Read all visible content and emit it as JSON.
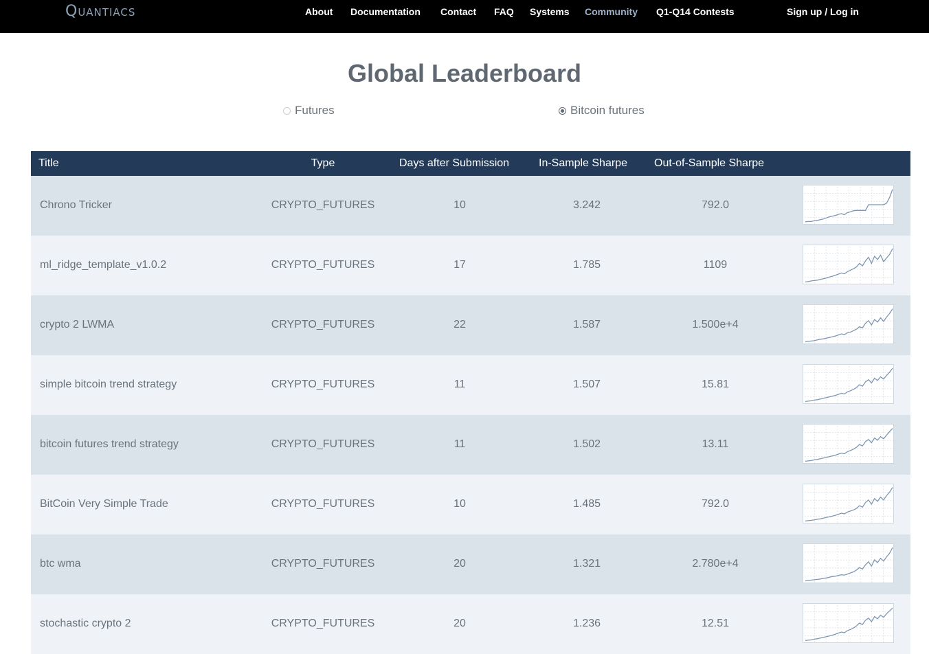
{
  "header": {
    "logo": "Quantiacs",
    "nav": [
      {
        "label": "About"
      },
      {
        "label": "Documentation"
      },
      {
        "label": "Contact"
      },
      {
        "label": "FAQ"
      },
      {
        "label": "Systems"
      },
      {
        "label": "Community"
      },
      {
        "label": "Q1-Q14 Contests"
      }
    ],
    "active_nav": "Community",
    "auth": "Sign up / Log in"
  },
  "page_title": "Global Leaderboard",
  "filters": {
    "options": [
      {
        "label": "Futures",
        "selected": false
      },
      {
        "label": "Bitcoin futures",
        "selected": true
      }
    ]
  },
  "table": {
    "columns": [
      "Title",
      "Type",
      "Days after Submission",
      "In-Sample Sharpe",
      "Out-of-Sample Sharpe",
      ""
    ],
    "rows": [
      {
        "title": "Chrono Tricker",
        "type": "CRYPTO_FUTURES",
        "days": "10",
        "is_sharpe": "3.242",
        "oos_sharpe": "792.0",
        "spark_icon": "equity-curve-icon",
        "curve": [
          0.04,
          0.05,
          0.05,
          0.07,
          0.08,
          0.1,
          0.12,
          0.15,
          0.18,
          0.2,
          0.22,
          0.25,
          0.27,
          0.24,
          0.3,
          0.32,
          0.35,
          0.36,
          0.36,
          0.36,
          0.36,
          0.52,
          0.52,
          0.52,
          0.52,
          0.52,
          0.52,
          0.56,
          0.72,
          0.95
        ]
      },
      {
        "title": "ml_ridge_template_v1.0.2",
        "type": "CRYPTO_FUTURES",
        "days": "17",
        "is_sharpe": "1.785",
        "oos_sharpe": "1109",
        "spark_icon": "equity-curve-icon",
        "curve": [
          0.03,
          0.04,
          0.06,
          0.07,
          0.08,
          0.1,
          0.12,
          0.14,
          0.17,
          0.19,
          0.22,
          0.25,
          0.28,
          0.26,
          0.32,
          0.36,
          0.4,
          0.45,
          0.55,
          0.48,
          0.62,
          0.72,
          0.55,
          0.75,
          0.66,
          0.78,
          0.6,
          0.7,
          0.8,
          0.96
        ]
      },
      {
        "title": "crypto 2 LWMA",
        "type": "CRYPTO_FUTURES",
        "days": "22",
        "is_sharpe": "1.587",
        "oos_sharpe": "1.500e+4",
        "spark_icon": "equity-curve-icon",
        "curve": [
          0.03,
          0.04,
          0.05,
          0.06,
          0.08,
          0.1,
          0.11,
          0.13,
          0.15,
          0.17,
          0.19,
          0.22,
          0.25,
          0.23,
          0.28,
          0.3,
          0.34,
          0.38,
          0.45,
          0.42,
          0.55,
          0.62,
          0.5,
          0.65,
          0.58,
          0.7,
          0.6,
          0.72,
          0.82,
          0.95
        ]
      },
      {
        "title": "simple bitcoin trend strategy",
        "type": "CRYPTO_FUTURES",
        "days": "11",
        "is_sharpe": "1.507",
        "oos_sharpe": "15.81",
        "spark_icon": "equity-curve-icon",
        "curve": [
          0.03,
          0.04,
          0.05,
          0.07,
          0.08,
          0.1,
          0.12,
          0.14,
          0.16,
          0.18,
          0.2,
          0.23,
          0.26,
          0.24,
          0.3,
          0.33,
          0.37,
          0.42,
          0.5,
          0.46,
          0.58,
          0.64,
          0.55,
          0.68,
          0.62,
          0.72,
          0.66,
          0.76,
          0.85,
          0.96
        ]
      },
      {
        "title": "bitcoin futures trend strategy",
        "type": "CRYPTO_FUTURES",
        "days": "11",
        "is_sharpe": "1.502",
        "oos_sharpe": "13.11",
        "spark_icon": "equity-curve-icon",
        "curve": [
          0.03,
          0.04,
          0.05,
          0.07,
          0.08,
          0.1,
          0.12,
          0.14,
          0.16,
          0.18,
          0.2,
          0.23,
          0.26,
          0.24,
          0.3,
          0.33,
          0.37,
          0.42,
          0.5,
          0.46,
          0.58,
          0.64,
          0.55,
          0.68,
          0.62,
          0.72,
          0.66,
          0.76,
          0.86,
          0.95
        ]
      },
      {
        "title": "BitCoin Very Simple Trade",
        "type": "CRYPTO_FUTURES",
        "days": "10",
        "is_sharpe": "1.485",
        "oos_sharpe": "792.0",
        "spark_icon": "equity-curve-icon",
        "curve": [
          0.03,
          0.04,
          0.05,
          0.06,
          0.08,
          0.09,
          0.11,
          0.13,
          0.15,
          0.17,
          0.19,
          0.22,
          0.25,
          0.23,
          0.28,
          0.31,
          0.34,
          0.38,
          0.46,
          0.42,
          0.55,
          0.62,
          0.5,
          0.66,
          0.58,
          0.7,
          0.62,
          0.74,
          0.84,
          0.97
        ]
      },
      {
        "title": "btc wma",
        "type": "CRYPTO_FUTURES",
        "days": "20",
        "is_sharpe": "1.321",
        "oos_sharpe": "2.780e+4",
        "spark_icon": "equity-curve-icon",
        "curve": [
          0.03,
          0.04,
          0.05,
          0.06,
          0.07,
          0.08,
          0.1,
          0.11,
          0.13,
          0.15,
          0.16,
          0.18,
          0.2,
          0.19,
          0.22,
          0.25,
          0.28,
          0.33,
          0.4,
          0.36,
          0.48,
          0.56,
          0.44,
          0.62,
          0.54,
          0.66,
          0.58,
          0.7,
          0.8,
          0.96
        ]
      },
      {
        "title": "stochastic crypto 2",
        "type": "CRYPTO_FUTURES",
        "days": "20",
        "is_sharpe": "1.236",
        "oos_sharpe": "12.51",
        "spark_icon": "equity-curve-icon",
        "curve": [
          0.03,
          0.04,
          0.05,
          0.07,
          0.08,
          0.1,
          0.12,
          0.14,
          0.16,
          0.18,
          0.21,
          0.24,
          0.27,
          0.25,
          0.31,
          0.34,
          0.38,
          0.44,
          0.52,
          0.48,
          0.6,
          0.66,
          0.56,
          0.7,
          0.64,
          0.74,
          0.68,
          0.78,
          0.86,
          0.94
        ]
      }
    ]
  },
  "colors": {
    "topbar": "#000000",
    "table_header": "#233a58",
    "row_odd": "#dbe3ea",
    "row_even": "#eff3f7",
    "spark_line": "#7f96b1",
    "active_nav": "#9bb0c9"
  }
}
